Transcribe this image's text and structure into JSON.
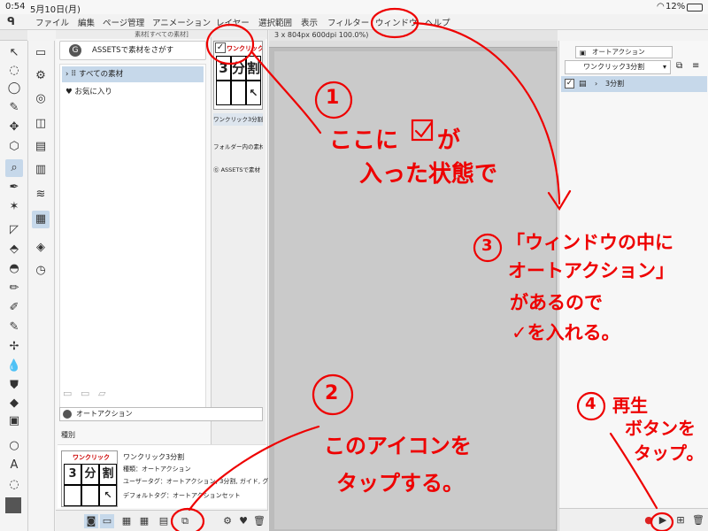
{
  "status_bar": {
    "time": "0:54",
    "date": "5月10日(月)",
    "battery": "12%"
  },
  "menu": {
    "items": [
      "ファイル",
      "編集",
      "ページ管理",
      "アニメーション",
      "レイヤー",
      "選択範囲",
      "表示",
      "フィルター",
      "ウィンドウ",
      "ヘルプ"
    ]
  },
  "material_panel": {
    "title": "素材[すべての素材]",
    "assets_button": "ASSETSで素材をさがす",
    "tree": [
      {
        "label": "すべての素材"
      },
      {
        "label": "お気に入り"
      }
    ],
    "thumb_title": "ワンクリック",
    "thumb_chars": [
      "3",
      "分",
      "割"
    ],
    "thumb_name": "ワンクリック3分割",
    "folder_label": "フォルダー内の素材をす",
    "assets_label": "ASSETSで素材",
    "search_placeholder": "オートアクション",
    "kind_label": "種別",
    "detail": {
      "name": "ワンクリック3分割",
      "type": "種類：オートアクション",
      "user_tags": "ユーザータグ：オートアクション, 3分割, ガイド, グリッド, ●",
      "default_tags": "デフォルトタグ：オートアクションセット"
    }
  },
  "canvas": {
    "title": "3 x 804px 600dpi 100.0%)"
  },
  "auto_action_panel": {
    "tab": "オートアクション",
    "set": "ワンクリック3分割",
    "row_label": "3分割"
  },
  "annotations": {
    "n1": "1",
    "n2": "2",
    "n3": "3",
    "n4": "4",
    "a1_line1": "ここに",
    "a1_line1b": "が",
    "a1_line2": "入った状態で",
    "a2_line1": "このアイコンを",
    "a2_line2": "タップする。",
    "a3_line1": "「ウィンドウの中に",
    "a3_line2": "オートアクション」",
    "a3_line3": "があるので",
    "a3_line4": "✓を入れる。",
    "a4_line1": "再生",
    "a4_line2": "ボタンを",
    "a4_line3": "タップ。",
    "color": "#ee0000"
  }
}
